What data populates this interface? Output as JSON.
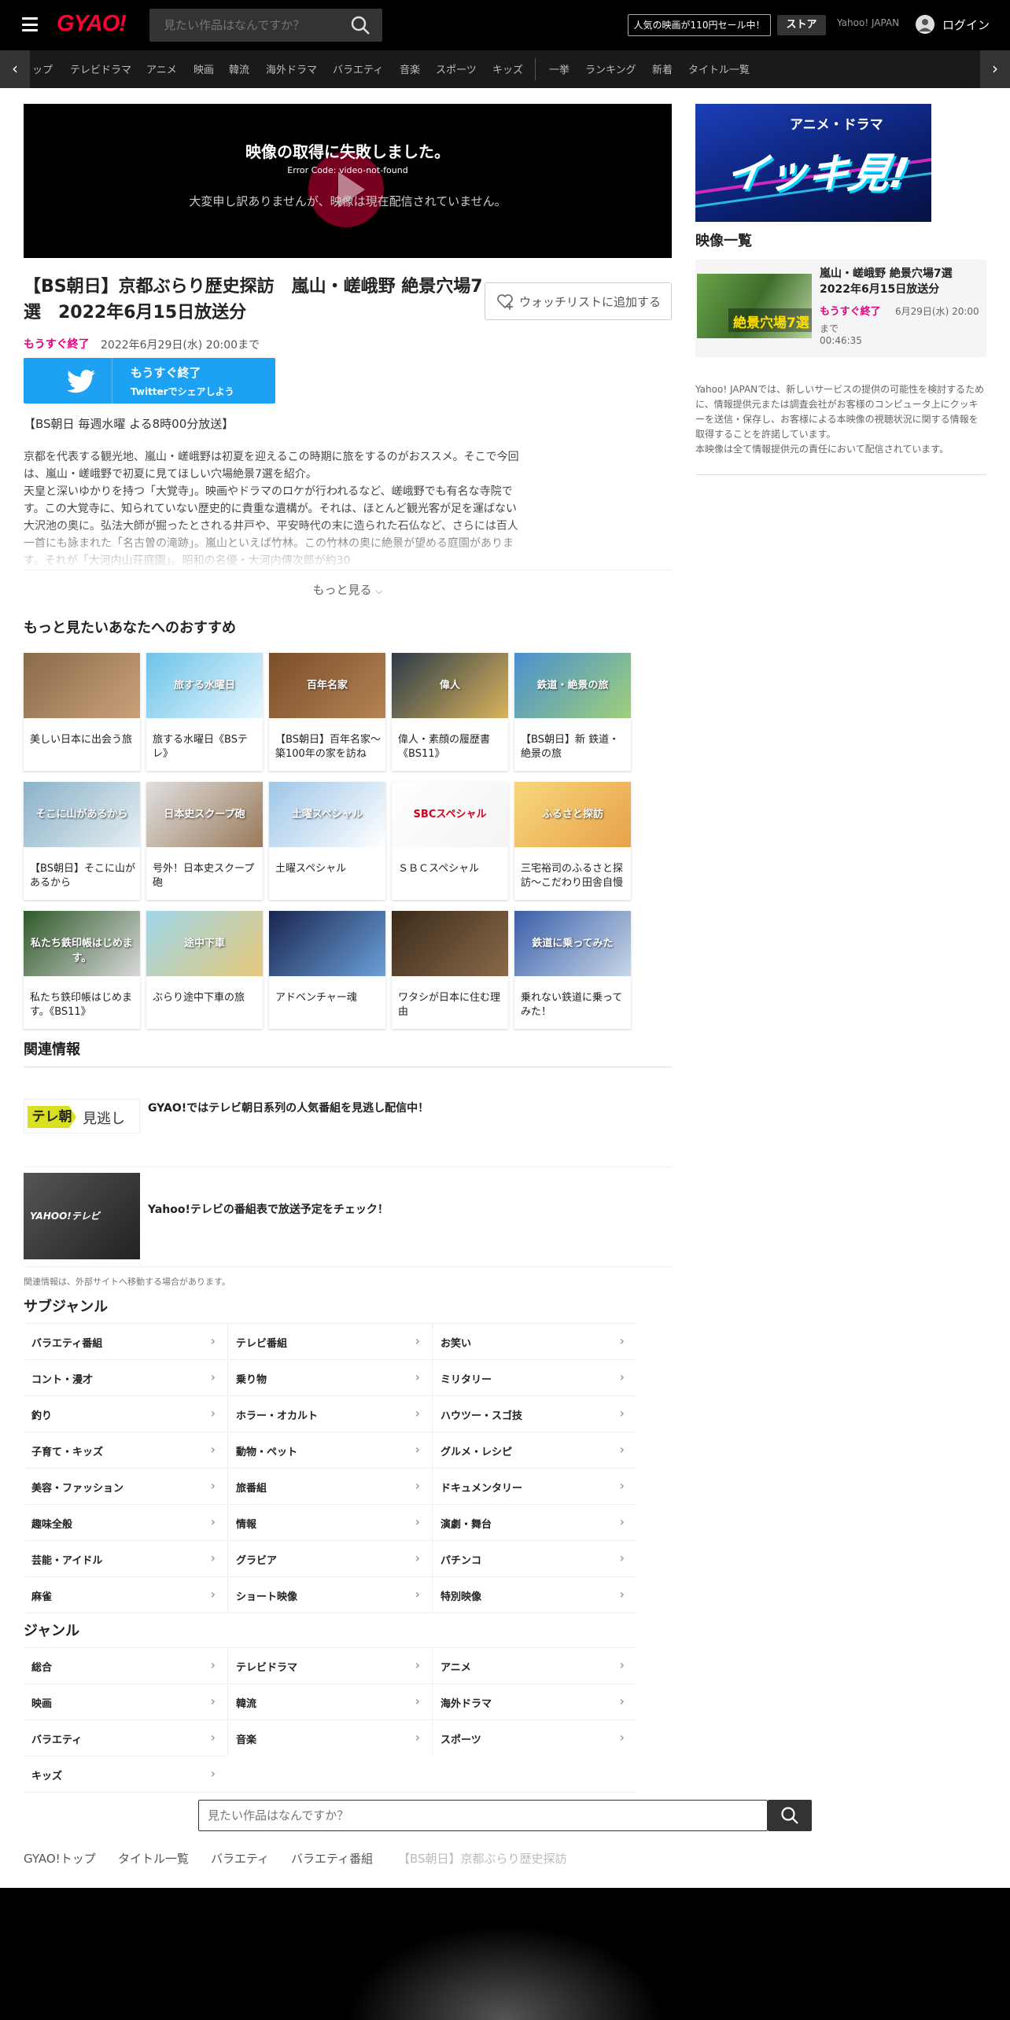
{
  "header": {
    "logo": "GYAO!",
    "search_placeholder": "見たい作品はなんですか？",
    "sale_banner": "人気の映画が110円セール中！",
    "store": "ストア",
    "yahoo_link": "Yahoo! JAPAN",
    "login": "ログイン"
  },
  "nav": {
    "items": [
      "トップ",
      "テレビドラマ",
      "アニメ",
      "映画",
      "韓流",
      "海外ドラマ",
      "バラエティ",
      "音楽",
      "スポーツ",
      "キッズ",
      "一挙",
      "ランキング",
      "新着",
      "タイトル一覧"
    ]
  },
  "player": {
    "error_title": "映像の取得に失敗しました。",
    "error_code": "Error Code: video-not-found",
    "error_message": "大変申し訳ありませんが、映像は現在配信されていません。"
  },
  "video": {
    "title": "【BS朝日】京都ぶらり歴史探訪　嵐山・嵯峨野 絶景穴場7選　2022年6月15日放送分",
    "watchlist": "ウォッチリストに追加する",
    "badge": "もうすぐ終了",
    "end_date": "2022年6月29日(水) 20:00まで",
    "twitter_line1": "もうすぐ終了",
    "twitter_line2": "Twitterでシェアしよう",
    "broadcast": "【BS朝日 毎週水曜 よる8時00分放送】",
    "description": "京都を代表する観光地、嵐山・嵯峨野は初夏を迎えるこの時期に旅をするのがおススメ。そこで今回は、嵐山・嵯峨野で初夏に見てほしい穴場絶景7選を紹介。\n天皇と深いゆかりを持つ「大覚寺」。映画やドラマのロケが行われるなど、嵯峨野でも有名な寺院です。この大覚寺に、知られていない歴史的に貴重な遺構が。それは、ほとんど観光客が足を運ばない大沢池の奥に。弘法大師が掘ったとされる井戸や、平安時代の末に造られた石仏など、さらには百人一首にも詠まれた「名古曽の滝跡」。嵐山といえば竹林。この竹林の奥に絶景が望める庭園があります。それが「大河内山荘庭園」。昭和の名優・大河内傳次郎が約30",
    "more": "もっと見る"
  },
  "recommend": {
    "title": "もっと見たいあなたへのおすすめ",
    "items": [
      {
        "title": "美しい日本に出会う旅"
      },
      {
        "title": "旅する水曜日《BSテレ》"
      },
      {
        "title": "【BS朝日】百年名家～築100年の家を訪ね"
      },
      {
        "title": "偉人・素顔の履歴書《BS11》"
      },
      {
        "title": "【BS朝日】新 鉄道・絶景の旅"
      },
      {
        "title": "【BS朝日】そこに山があるから"
      },
      {
        "title": "号外！日本史スクープ砲"
      },
      {
        "title": "土曜スペシャル"
      },
      {
        "title": "ＳＢＣスペシャル"
      },
      {
        "title": "三宅裕司のふるさと探訪～こだわり田舎自慢"
      },
      {
        "title": "私たち鉄印帳はじめます。《BS11》"
      },
      {
        "title": "ぶらり途中下車の旅"
      },
      {
        "title": "アドベンチャー魂"
      },
      {
        "title": "ワタシが日本に住む理由"
      },
      {
        "title": "乗れない鉄道に乗ってみた！"
      }
    ],
    "thumb_texts": [
      "",
      "旅する水曜日",
      "百年名家",
      "偉人",
      "鉄道・絶景の旅",
      "そこに山があるから",
      "日本史スクープ砲",
      "土曜スペシャル",
      "SBCスペシャル",
      "ふるさと探訪",
      "私たち鉄印帳はじめます。",
      "途中下車",
      "",
      "",
      "鉄道に乗ってみた"
    ]
  },
  "related": {
    "title": "関連情報",
    "tv_logo": "テレ朝",
    "tv_logo_2": "見逃し",
    "tv_text": "GYAO!ではテレビ朝日系列の人気番組を見逃し配信中！",
    "yahoo_logo": "YAHOO!テレビ",
    "yahoo_text": "Yahoo!テレビの番組表で放送予定をチェック！",
    "note": "関連情報は、外部サイトへ移動する場合があります。"
  },
  "subgenre": {
    "title": "サブジャンル",
    "items": [
      "バラエティ番組",
      "テレビ番組",
      "お笑い",
      "コント・漫才",
      "乗り物",
      "ミリタリー",
      "釣り",
      "ホラー・オカルト",
      "ハウツー・スゴ技",
      "子育て・キッズ",
      "動物・ペット",
      "グルメ・レシピ",
      "美容・ファッション",
      "旅番組",
      "ドキュメンタリー",
      "趣味全般",
      "情報",
      "演劇・舞台",
      "芸能・アイドル",
      "グラビア",
      "パチンコ",
      "麻雀",
      "ショート映像",
      "特別映像"
    ]
  },
  "genre": {
    "title": "ジャンル",
    "items": [
      "総合",
      "テレビドラマ",
      "アニメ",
      "映画",
      "韓流",
      "海外ドラマ",
      "バラエティ",
      "音楽",
      "スポーツ",
      "キッズ"
    ]
  },
  "bottom_search": {
    "placeholder": "見たい作品はなんですか？"
  },
  "breadcrumbs": [
    "GYAO!トップ",
    "タイトル一覧",
    "バラエティ",
    "バラエティ番組",
    "【BS朝日】京都ぶらり歴史探訪"
  ],
  "sidebar": {
    "promo_small": "アニメ・ドラマ",
    "promo_big": "イッキ見!",
    "video_list_title": "映像一覧",
    "item": {
      "title": "嵐山・嵯峨野 絶景穴場7選　2022年6月15日放送分",
      "badge": "もうすぐ終了",
      "date": "6月29日(水) 20:00",
      "until": "まで",
      "duration": "00:46:35",
      "thumb_text": "絶景穴場7選"
    },
    "note": "Yahoo! JAPANでは、新しいサービスの提供の可能性を検討するために、情報提供元または調査会社がお客様のコンピュータ上にクッキーを送信・保存し、お客様による本映像の視聴状況に関する情報を取得することを許諾しています。\n本映像は全て情報提供元の責任において配信されています。"
  },
  "colors": {
    "accent": "#ff0033",
    "ending": "#e3007f",
    "twitter": "#1da1f2"
  }
}
